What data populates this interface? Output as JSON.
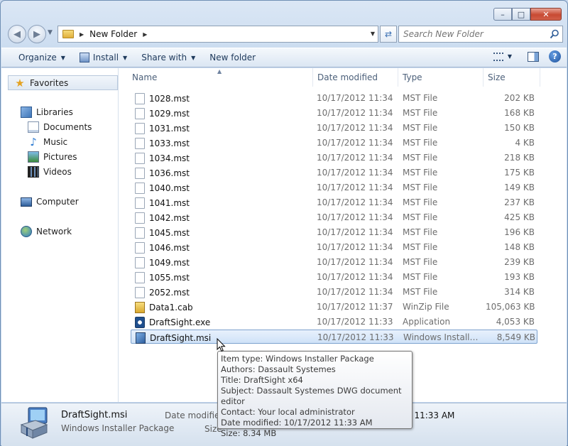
{
  "window": {
    "minimize_label": "–",
    "maximize_label": "□",
    "close_label": "✕"
  },
  "address": {
    "path": "New Folder",
    "search_placeholder": "Search New Folder"
  },
  "toolbar": {
    "organize_label": "Organize",
    "install_label": "Install",
    "share_label": "Share with",
    "new_folder_label": "New folder"
  },
  "nav": {
    "favorites": "Favorites",
    "libraries": "Libraries",
    "documents": "Documents",
    "music": "Music",
    "pictures": "Pictures",
    "videos": "Videos",
    "computer": "Computer",
    "network": "Network"
  },
  "columns": {
    "name": "Name",
    "date": "Date modified",
    "type": "Type",
    "size": "Size"
  },
  "files": [
    {
      "name": "1028.mst",
      "date": "10/17/2012 11:34 ...",
      "type": "MST File",
      "size": "202 KB",
      "icon": "document-icon"
    },
    {
      "name": "1029.mst",
      "date": "10/17/2012 11:34 ...",
      "type": "MST File",
      "size": "168 KB",
      "icon": "document-icon"
    },
    {
      "name": "1031.mst",
      "date": "10/17/2012 11:34 ...",
      "type": "MST File",
      "size": "150 KB",
      "icon": "document-icon"
    },
    {
      "name": "1033.mst",
      "date": "10/17/2012 11:34 ...",
      "type": "MST File",
      "size": "4 KB",
      "icon": "document-icon"
    },
    {
      "name": "1034.mst",
      "date": "10/17/2012 11:34 ...",
      "type": "MST File",
      "size": "218 KB",
      "icon": "document-icon"
    },
    {
      "name": "1036.mst",
      "date": "10/17/2012 11:34 ...",
      "type": "MST File",
      "size": "175 KB",
      "icon": "document-icon"
    },
    {
      "name": "1040.mst",
      "date": "10/17/2012 11:34 ...",
      "type": "MST File",
      "size": "149 KB",
      "icon": "document-icon"
    },
    {
      "name": "1041.mst",
      "date": "10/17/2012 11:34 ...",
      "type": "MST File",
      "size": "237 KB",
      "icon": "document-icon"
    },
    {
      "name": "1042.mst",
      "date": "10/17/2012 11:34 ...",
      "type": "MST File",
      "size": "425 KB",
      "icon": "document-icon"
    },
    {
      "name": "1045.mst",
      "date": "10/17/2012 11:34 ...",
      "type": "MST File",
      "size": "196 KB",
      "icon": "document-icon"
    },
    {
      "name": "1046.mst",
      "date": "10/17/2012 11:34 ...",
      "type": "MST File",
      "size": "148 KB",
      "icon": "document-icon"
    },
    {
      "name": "1049.mst",
      "date": "10/17/2012 11:34 ...",
      "type": "MST File",
      "size": "239 KB",
      "icon": "document-icon"
    },
    {
      "name": "1055.mst",
      "date": "10/17/2012 11:34 ...",
      "type": "MST File",
      "size": "193 KB",
      "icon": "document-icon"
    },
    {
      "name": "2052.mst",
      "date": "10/17/2012 11:34 ...",
      "type": "MST File",
      "size": "314 KB",
      "icon": "document-icon"
    },
    {
      "name": "Data1.cab",
      "date": "10/17/2012 11:37 ...",
      "type": "WinZip File",
      "size": "105,063 KB",
      "icon": "cab-archive-icon"
    },
    {
      "name": "DraftSight.exe",
      "date": "10/17/2012 11:33 ...",
      "type": "Application",
      "size": "4,053 KB",
      "icon": "application-icon"
    },
    {
      "name": "DraftSight.msi",
      "date": "10/17/2012 11:33 ...",
      "type": "Windows Installer ...",
      "size": "8,549 KB",
      "icon": "installer-icon",
      "selected": true
    }
  ],
  "tooltip": {
    "line1": "Item type: Windows Installer Package",
    "line2": "Authors: Dassault Systemes",
    "line3": "Title: DraftSight x64",
    "line4": "Subject: Dassault Systemes DWG document editor",
    "line5": "Contact:  Your local administrator",
    "line6": "Date modified: 10/17/2012 11:33 AM",
    "line7": "Size: 8.34 MB"
  },
  "details": {
    "name": "DraftSight.msi",
    "type": "Windows Installer Package",
    "date_label": "Date modified",
    "date_value": "2 11:33 AM",
    "size_label": "Size"
  }
}
